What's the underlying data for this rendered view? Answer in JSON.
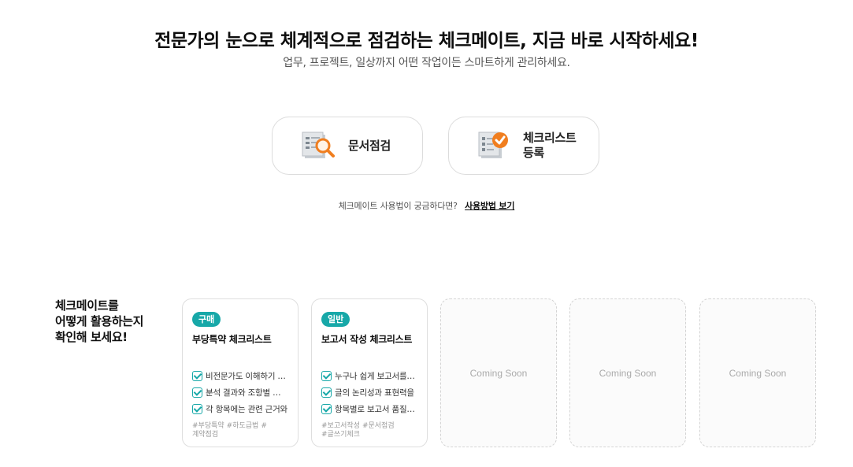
{
  "hero": {
    "title": "전문가의 눈으로 체계적으로 점검하는 체크메이트, 지금 바로 시작하세요!",
    "subtitle": "업무, 프로젝트, 일상까지 어떤 작업이든 스마트하게 관리하세요."
  },
  "actions": {
    "doc_check": {
      "label": "문서점검",
      "icon": "document-search-icon"
    },
    "checklist_register": {
      "label_line1": "체크리스트",
      "label_line2": "등록",
      "icon": "document-check-icon"
    }
  },
  "howto": {
    "question": "체크메이트 사용법이 궁금하다면?",
    "link": "사용방법 보기"
  },
  "showcase": {
    "title_line1": "체크메이트를",
    "title_line2": "어떻게 활용하는지",
    "title_line3": "확인해 보세요!",
    "cards": [
      {
        "badge": "구매",
        "title": "부당특약 체크리스트",
        "items": [
          "비전문가도 이해하기 쉽게",
          "분석 결과와 조항별 위험도",
          "각 항목에는 관련 근거와"
        ],
        "tags": [
          "#부당특약",
          "#하도급법",
          "#계약점검"
        ]
      },
      {
        "badge": "일반",
        "title": "보고서 작성 체크리스트",
        "items": [
          "누구나 쉽게 보고서를 작성",
          "글의 논리성과 표현력을",
          "항목별로 보고서 품질 점검"
        ],
        "tags": [
          "#보고서작성",
          "#문서점검",
          "#글쓰기체크"
        ]
      }
    ],
    "coming_soon": [
      "Coming Soon",
      "Coming Soon",
      "Coming Soon"
    ]
  },
  "colors": {
    "accent": "#17a8a8",
    "icon_orange": "#f07e1f"
  }
}
